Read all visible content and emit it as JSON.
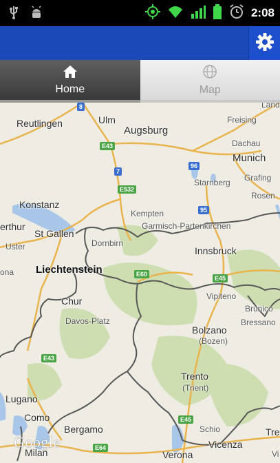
{
  "status_bar": {
    "time": "2:08",
    "icons": [
      "usb-icon",
      "android-debug-icon",
      "gps-icon",
      "wifi-icon",
      "signal-icon",
      "battery-icon",
      "alarm-icon"
    ]
  },
  "action_bar": {
    "settings_icon": "gear-icon"
  },
  "tabs": [
    {
      "label": "Home",
      "icon": "home-icon",
      "selected": true
    },
    {
      "label": "Map",
      "icon": "map-globe-icon",
      "selected": false
    }
  ],
  "map": {
    "places": {
      "reutlingen": "Reutlingen",
      "ulm": "Ulm",
      "augsburg": "Augsburg",
      "freising": "Freising",
      "dachau": "Dachau",
      "munich": "Munich",
      "starnberg": "Starnberg",
      "grafing": "Grafing",
      "rosenheim": "Rosen",
      "konstanz": "Konstanz",
      "kempten": "Kempten",
      "garmisch": "Garmisch-Partenkirchen",
      "thur": "erthur",
      "st_gallen": "St Gallen",
      "dornbirn": "Dornbirn",
      "uster": "Uster",
      "innsbruck": "Innsbruck",
      "liechtenstein": "Liechtenstein",
      "zona": "ona",
      "chur": "Chur",
      "vipiteno": "Vipiteno",
      "brunico": "Brunico",
      "bressanone": "Bressano",
      "davos": "Davos-Platz",
      "bolzano": "Bolzano",
      "bozen": "(Bozen)",
      "trento": "Trento",
      "trient": "(Trient)",
      "lugano": "Lugano",
      "como": "Como",
      "bergamo": "Bergamo",
      "schio": "Schio",
      "vicenza": "Vicenza",
      "milan": "Milan",
      "verona": "Verona",
      "landshut": "Lands",
      "treviso": "Tre",
      "vi": "Vi"
    },
    "shields": {
      "s8": "8",
      "e43a": "E43",
      "s7": "7",
      "e532": "E532",
      "s96": "96",
      "s95": "95",
      "e60": "E60",
      "e45a": "E45",
      "e43b": "E43",
      "e45b": "E45",
      "e64": "E64"
    },
    "logo": "Google"
  },
  "colors": {
    "action_bar": "#1b49b7",
    "map_land": "#efece4",
    "water": "#a8c6e8",
    "forest": "#c8dca8",
    "border": "#555555",
    "highway_shield": "#4aa546"
  }
}
